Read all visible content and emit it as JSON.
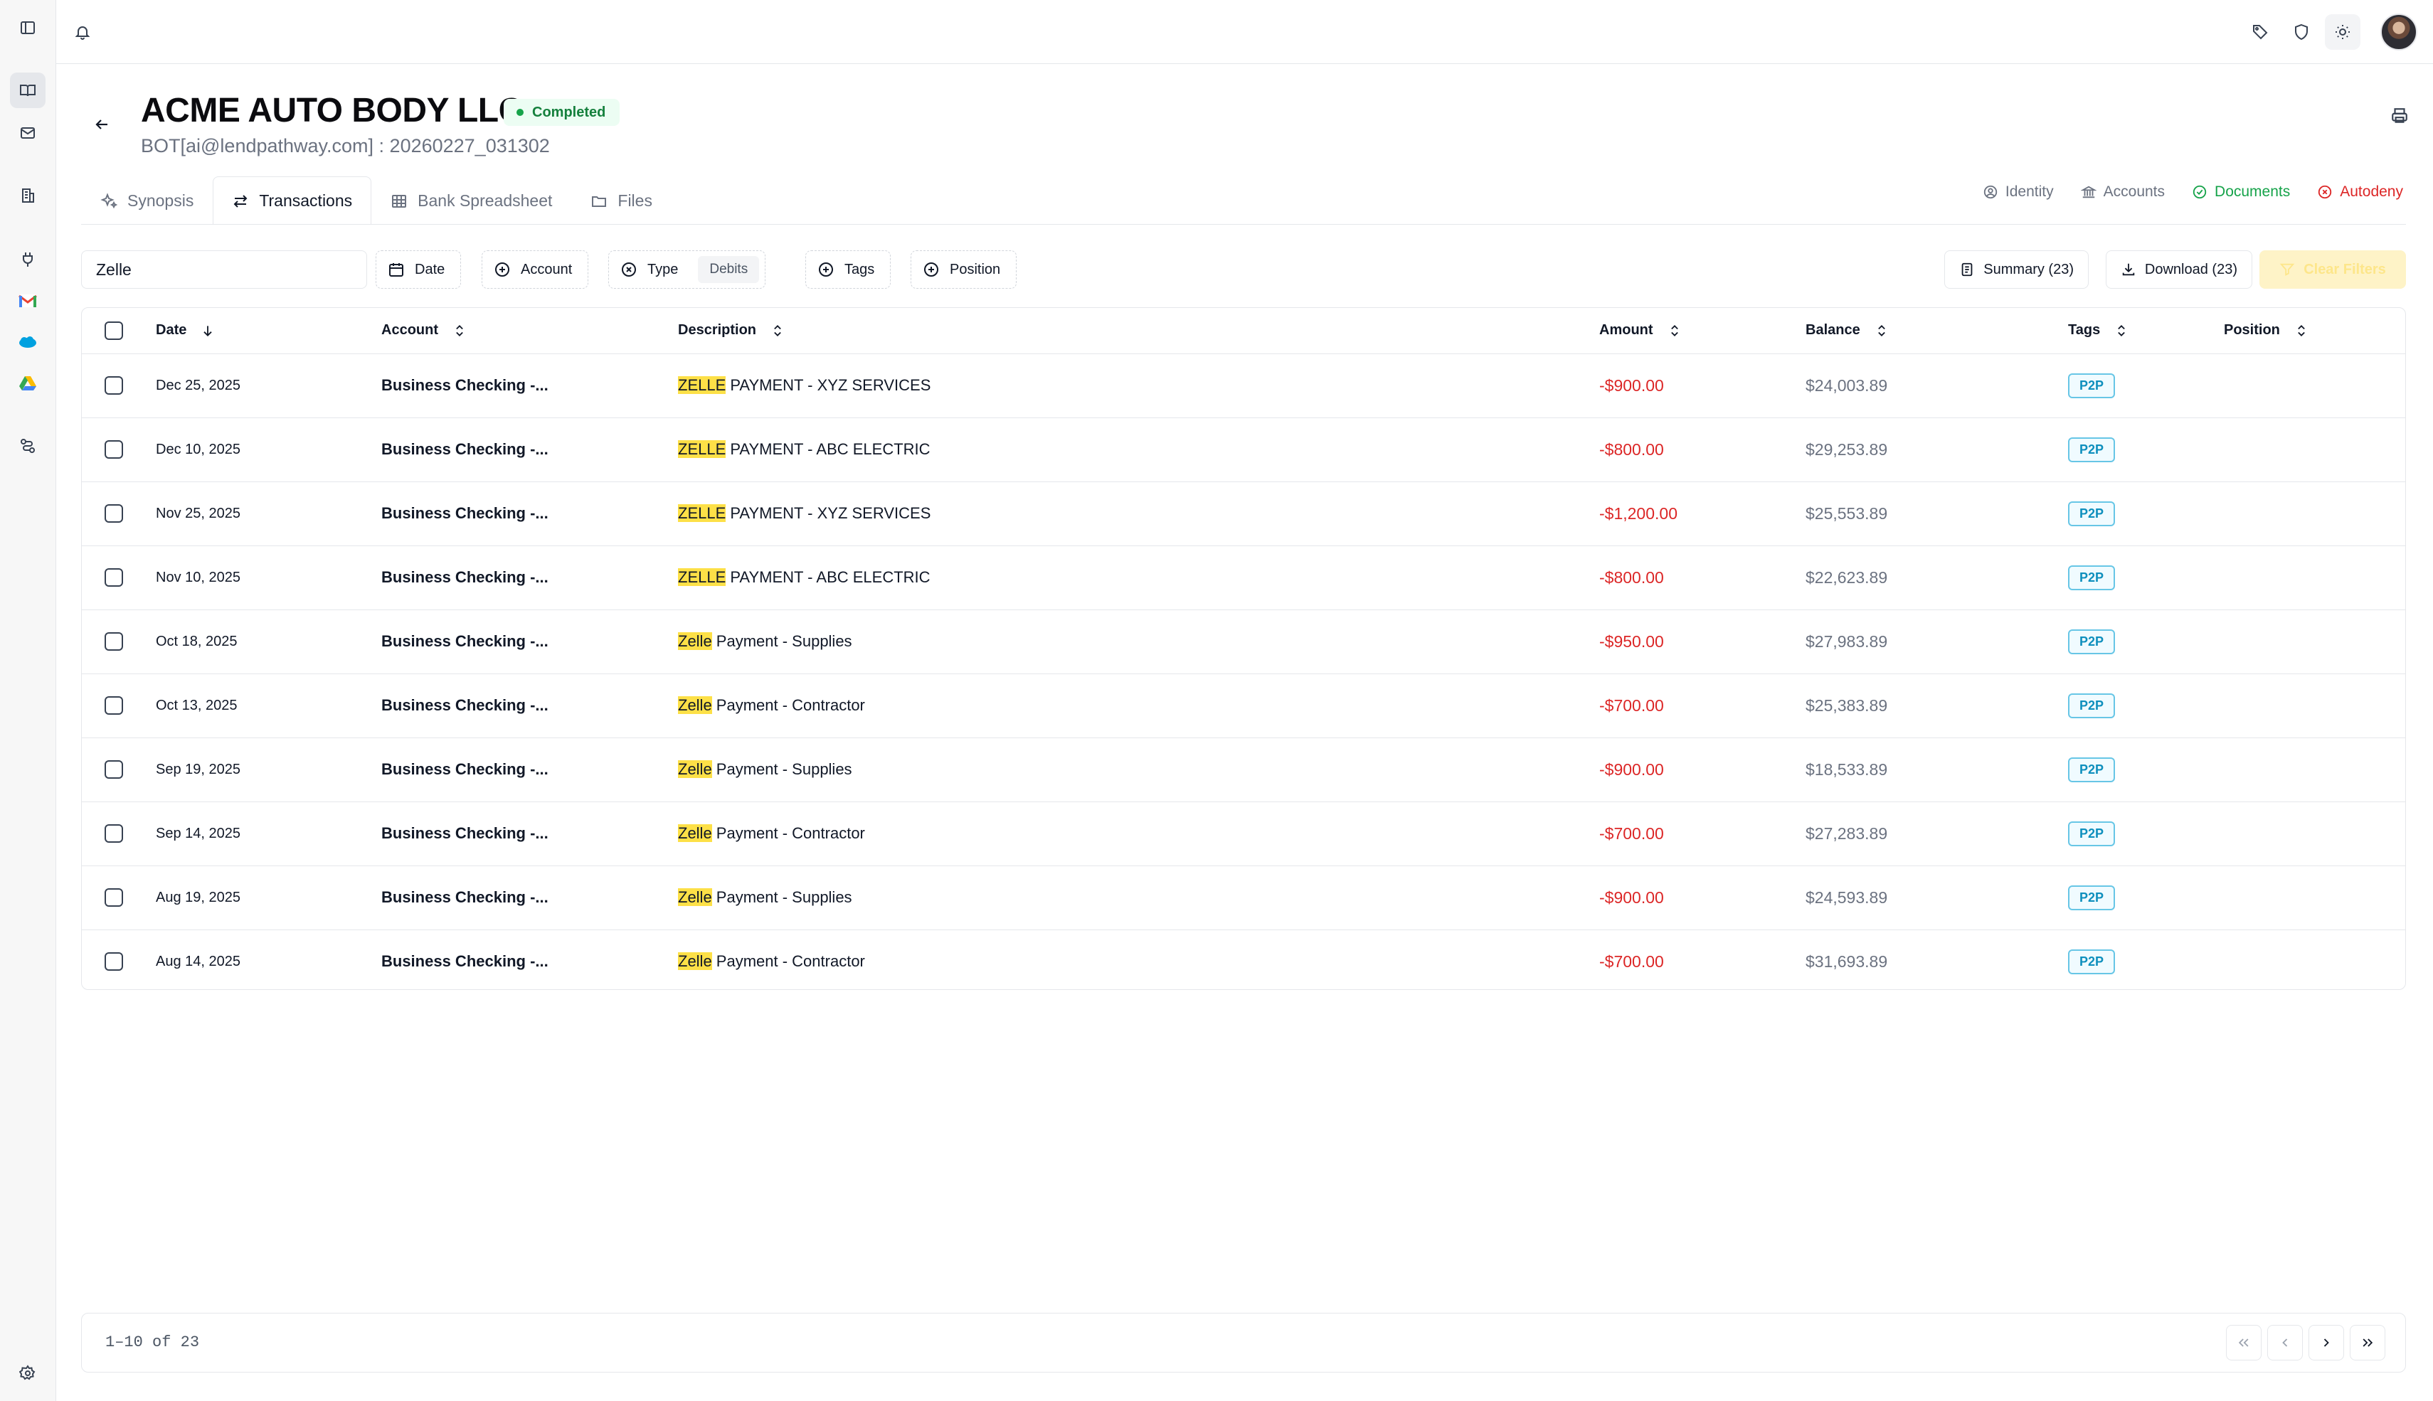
{
  "header": {
    "title": "ACME AUTO BODY LLC",
    "status": "Completed",
    "subtitle": "BOT[ai@lendpathway.com] : 20260227_031302"
  },
  "tabs": [
    {
      "label": "Synopsis",
      "icon": "sparkles-icon"
    },
    {
      "label": "Transactions",
      "icon": "arrows-left-right-icon",
      "active": true
    },
    {
      "label": "Bank Spreadsheet",
      "icon": "table-icon"
    },
    {
      "label": "Files",
      "icon": "folder-icon"
    }
  ],
  "right_links": [
    {
      "label": "Identity",
      "icon": "user-circle-icon",
      "color": "#6b7280"
    },
    {
      "label": "Accounts",
      "icon": "bank-icon",
      "color": "#6b7280"
    },
    {
      "label": "Documents",
      "icon": "check-circle-icon",
      "color": "#16a34a"
    },
    {
      "label": "Autodeny",
      "icon": "x-circle-icon",
      "color": "#dc2626"
    }
  ],
  "filters": {
    "search_value": "Zelle",
    "date_label": "Date",
    "account_label": "Account",
    "type_label": "Type",
    "type_chip": "Debits",
    "tags_label": "Tags",
    "position_label": "Position",
    "summary_label": "Summary (23)",
    "download_label": "Download (23)",
    "clear_label": "Clear Filters"
  },
  "table": {
    "columns": {
      "date": "Date",
      "account": "Account",
      "description": "Description",
      "amount": "Amount",
      "balance": "Balance",
      "tags": "Tags",
      "position": "Position"
    },
    "rows": [
      {
        "date": "Dec 25, 2025",
        "account": "Business Checking -...",
        "desc_match": "ZELLE",
        "desc_rest": " PAYMENT - XYZ SERVICES",
        "amount": "-$900.00",
        "balance": "$24,003.89",
        "tag": "P2P"
      },
      {
        "date": "Dec 10, 2025",
        "account": "Business Checking -...",
        "desc_match": "ZELLE",
        "desc_rest": " PAYMENT - ABC ELECTRIC",
        "amount": "-$800.00",
        "balance": "$29,253.89",
        "tag": "P2P"
      },
      {
        "date": "Nov 25, 2025",
        "account": "Business Checking -...",
        "desc_match": "ZELLE",
        "desc_rest": " PAYMENT - XYZ SERVICES",
        "amount": "-$1,200.00",
        "balance": "$25,553.89",
        "tag": "P2P"
      },
      {
        "date": "Nov 10, 2025",
        "account": "Business Checking -...",
        "desc_match": "ZELLE",
        "desc_rest": " PAYMENT - ABC ELECTRIC",
        "amount": "-$800.00",
        "balance": "$22,623.89",
        "tag": "P2P"
      },
      {
        "date": "Oct 18, 2025",
        "account": "Business Checking -...",
        "desc_match": "Zelle",
        "desc_rest": " Payment - Supplies",
        "amount": "-$950.00",
        "balance": "$27,983.89",
        "tag": "P2P"
      },
      {
        "date": "Oct 13, 2025",
        "account": "Business Checking -...",
        "desc_match": "Zelle",
        "desc_rest": " Payment - Contractor",
        "amount": "-$700.00",
        "balance": "$25,383.89",
        "tag": "P2P"
      },
      {
        "date": "Sep 19, 2025",
        "account": "Business Checking -...",
        "desc_match": "Zelle",
        "desc_rest": " Payment - Supplies",
        "amount": "-$900.00",
        "balance": "$18,533.89",
        "tag": "P2P"
      },
      {
        "date": "Sep 14, 2025",
        "account": "Business Checking -...",
        "desc_match": "Zelle",
        "desc_rest": " Payment - Contractor",
        "amount": "-$700.00",
        "balance": "$27,283.89",
        "tag": "P2P"
      },
      {
        "date": "Aug 19, 2025",
        "account": "Business Checking -...",
        "desc_match": "Zelle",
        "desc_rest": " Payment - Supplies",
        "amount": "-$900.00",
        "balance": "$24,593.89",
        "tag": "P2P"
      },
      {
        "date": "Aug 14, 2025",
        "account": "Business Checking -...",
        "desc_match": "Zelle",
        "desc_rest": " Payment - Contractor",
        "amount": "-$700.00",
        "balance": "$31,693.89",
        "tag": "P2P"
      }
    ]
  },
  "footer": {
    "range_text": "1–10 of 23"
  },
  "colors": {
    "debit": "#dc2626",
    "highlight": "#fde047",
    "tag_border": "#67c6e6",
    "status_green": "#15803d"
  }
}
